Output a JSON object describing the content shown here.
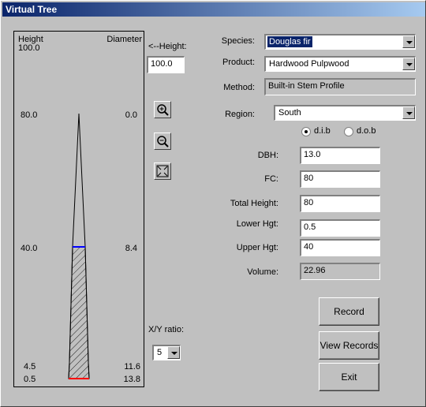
{
  "window": {
    "title": "Virtual Tree"
  },
  "tree_panel": {
    "height_header": "Height",
    "height_top": "100.0",
    "diameter_header": "Diameter",
    "labels": [
      {
        "height": "80.0",
        "diameter": "0.0"
      },
      {
        "height": "40.0",
        "diameter": "8.4"
      },
      {
        "height": "4.5",
        "diameter": "11.6"
      },
      {
        "height": "0.5",
        "diameter": "13.8"
      }
    ]
  },
  "height_control": {
    "label": "<--Height:",
    "value": "100.0"
  },
  "zoom": {
    "zoom_in": "zoom-in-icon",
    "zoom_out": "zoom-out-icon",
    "fit": "fit-icon"
  },
  "ratio": {
    "label": "X/Y ratio:",
    "value": "5"
  },
  "form": {
    "species_label": "Species:",
    "species_value": "Douglas fir",
    "product_label": "Product:",
    "product_value": "Hardwood Pulpwood",
    "method_label": "Method:",
    "method_value": "Built-in Stem Profile",
    "region_label": "Region:",
    "region_value": "South",
    "radio_dib": "d.i.b",
    "radio_dob": "d.o.b",
    "dbh_label": "DBH:",
    "dbh_value": "13.0",
    "fc_label": "FC:",
    "fc_value": "80",
    "total_height_label": "Total Height:",
    "total_height_value": "80",
    "lower_hgt_label": "Lower Hgt:",
    "lower_hgt_value": "0.5",
    "upper_hgt_label": "Upper Hgt:",
    "upper_hgt_value": "40",
    "volume_label": "Volume:",
    "volume_value": "22.96"
  },
  "buttons": {
    "record": "Record",
    "view_records": "View Records",
    "exit": "Exit"
  },
  "colors": {
    "upper_marker": "#0000ff",
    "lower_marker": "#ff0000",
    "title_bar": "#0a246a"
  }
}
